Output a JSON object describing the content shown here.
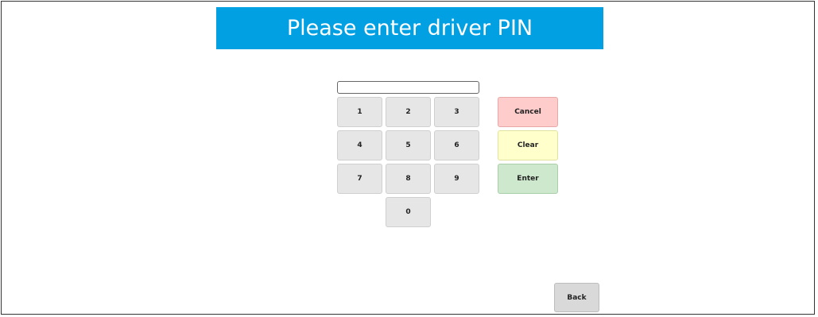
{
  "header": {
    "title": "Please enter driver PIN"
  },
  "pin_input": {
    "value": "",
    "placeholder": ""
  },
  "keypad": {
    "keys": [
      "1",
      "2",
      "3",
      "4",
      "5",
      "6",
      "7",
      "8",
      "9",
      "0"
    ]
  },
  "actions": {
    "cancel_label": "Cancel",
    "clear_label": "Clear",
    "enter_label": "Enter"
  },
  "footer": {
    "back_label": "Back"
  },
  "colors": {
    "title_bar": "#00a0e3",
    "cancel": "#ffcccc",
    "clear": "#ffffcc",
    "enter": "#cde8cd",
    "key": "#e6e6e6",
    "back": "#d9d9d9"
  }
}
